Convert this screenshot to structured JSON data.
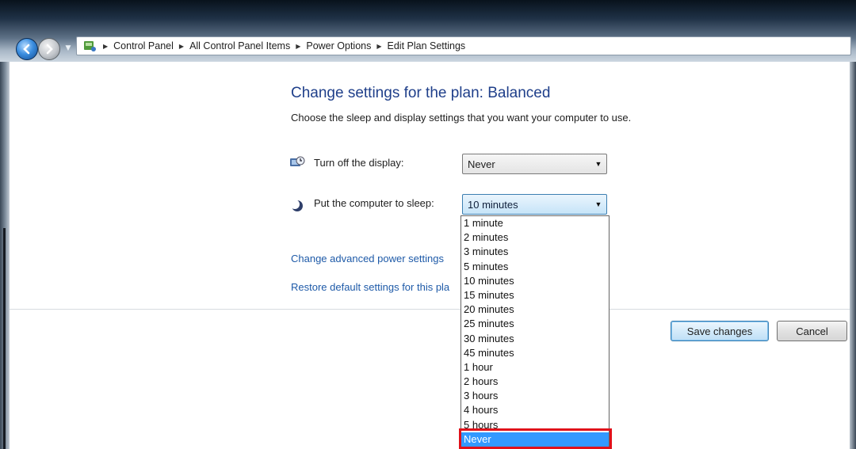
{
  "address_bar": {
    "breadcrumbs": [
      "Control Panel",
      "All Control Panel Items",
      "Power Options",
      "Edit Plan Settings"
    ],
    "icon": "control-panel-icon"
  },
  "nav": {
    "back_icon": "back-arrow-icon",
    "forward_icon": "forward-arrow-icon",
    "dropdown_icon": "chevron-down-icon"
  },
  "page": {
    "title": "Change settings for the plan: Balanced",
    "description": "Choose the sleep and display settings that you want your computer to use."
  },
  "settings": {
    "display": {
      "label": "Turn off the display:",
      "value": "Never",
      "icon": "display-power-icon"
    },
    "sleep": {
      "label": "Put the computer to sleep:",
      "value": "10 minutes",
      "icon": "sleep-moon-icon"
    }
  },
  "links": {
    "advanced": "Change advanced power settings",
    "restore": "Restore default settings for this pla"
  },
  "buttons": {
    "save": "Save changes",
    "cancel": "Cancel"
  },
  "sleep_options": [
    "1 minute",
    "2 minutes",
    "3 minutes",
    "5 minutes",
    "10 minutes",
    "15 minutes",
    "20 minutes",
    "25 minutes",
    "30 minutes",
    "45 minutes",
    "1 hour",
    "2 hours",
    "3 hours",
    "4 hours",
    "5 hours",
    "Never"
  ],
  "highlighted_option": "Never",
  "colors": {
    "title": "#1f3f8a",
    "link": "#1e5aa8",
    "selection": "#3399ff",
    "annotation": "#e0111a"
  }
}
